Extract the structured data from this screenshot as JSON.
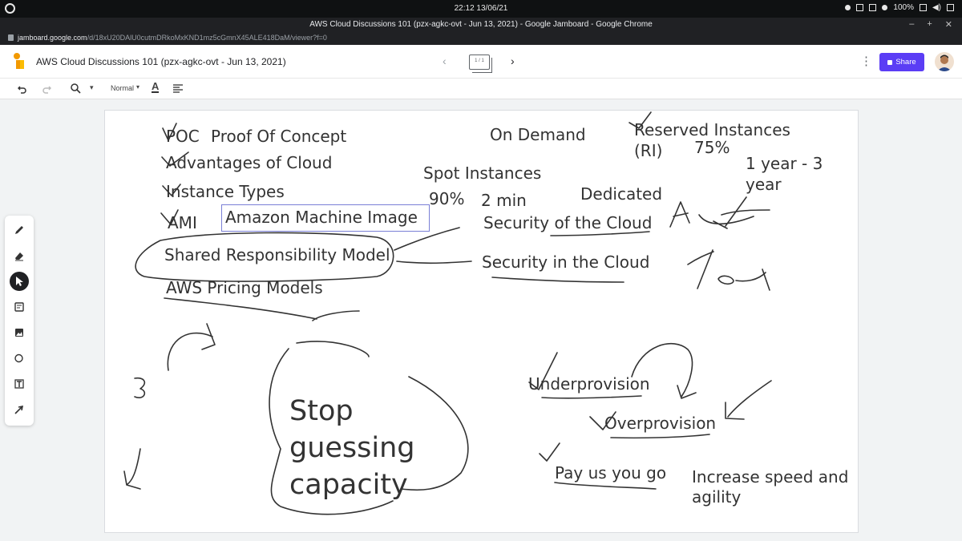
{
  "os": {
    "clock": "22:12  13/06/21",
    "battery": "100%"
  },
  "window": {
    "title": "AWS Cloud Discussions 101 (pzx-agkc-ovt - Jun 13, 2021) - Google Jamboard - Google Chrome"
  },
  "address": {
    "host": "jamboard.google.com",
    "path": "/d/18xU20DAlU0cutmDRkoMxKND1mz5cGmnX45ALE418DaM/viewer?f=0"
  },
  "header": {
    "title": "AWS Cloud Discussions 101 (pzx-agkc-ovt - Jun 13, 2021)",
    "frame_indicator": "1 / 1",
    "share_label": "Share"
  },
  "toolbar": {
    "text_style": "Normal"
  },
  "board": {
    "left_list": [
      "POC",
      "Proof Of Concept",
      "Advantages of Cloud",
      "Instance Types",
      "AMI",
      "Amazon Machine Image",
      "Shared Responsibility Model",
      "AWS Pricing Models"
    ],
    "on_demand": "On Demand",
    "reserved": "Reserved Instances",
    "reserved_abbr": "(RI)",
    "reserved_pct": "75%",
    "term_line1": "1 year - 3",
    "term_line2": "year",
    "spot": "Spot Instances",
    "spot_pct": "90%",
    "spot_notice": "2 min",
    "dedicated": "Dedicated",
    "security_of": "Security of the Cloud",
    "security_in": "Security in the Cloud",
    "stop_line1": "Stop",
    "stop_line2": "guessing",
    "stop_line3": "capacity",
    "underprovision": "Underprovision",
    "overprovision": "Overprovision",
    "pay": "Pay us you go",
    "speed_line1": "Increase speed and",
    "speed_line2": "agility"
  },
  "icons": [
    "os-logo-icon",
    "lock-icon",
    "jamboard-logo-icon",
    "prev-frame-icon",
    "next-frame-icon",
    "more-icon",
    "undo-icon",
    "redo-icon",
    "zoom-icon",
    "text-color-icon",
    "align-icon",
    "pen-icon",
    "eraser-icon",
    "select-icon",
    "sticky-note-icon",
    "image-icon",
    "circle-icon",
    "text-box-icon",
    "laser-icon"
  ]
}
